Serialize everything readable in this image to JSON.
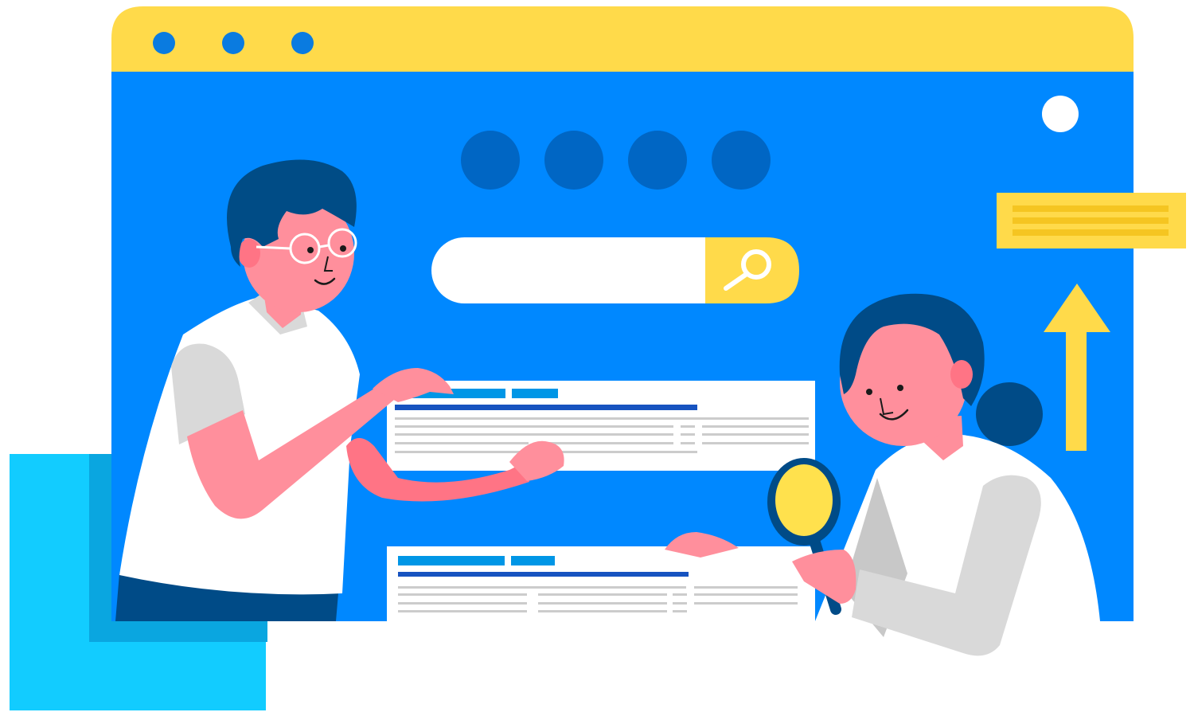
{
  "colors": {
    "window_bar": "#FFDA4A",
    "window_body": "#0088FF",
    "dark_blue": "#004B87",
    "hair": "#004C86",
    "skin": "#FF8F9C",
    "skin_dark": "#FF7485",
    "shirt": "#FFFFFF",
    "sleeve": "#D9D9D9",
    "cyan": "#12CCFF",
    "cyan_shadow": "#0AA6E0",
    "result_link": "#0096E6",
    "result_title": "#1753C0",
    "result_text": "#CCCCCC",
    "yellow": "#FFDA4A",
    "yellow_dark": "#F5C521"
  },
  "icons": {
    "window_controls": [
      "window-dot-icon",
      "window-dot-icon",
      "window-dot-icon"
    ],
    "search": "magnifier-icon",
    "arrow": "arrow-up-icon"
  },
  "nav_dots": 4,
  "results": 2
}
